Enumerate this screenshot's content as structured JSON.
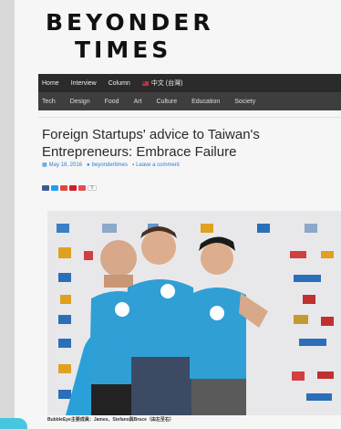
{
  "site": {
    "logo_line1": "BEYONDER",
    "logo_line2": "TIMES"
  },
  "nav_primary": [
    {
      "label": "Home"
    },
    {
      "label": "Interview"
    },
    {
      "label": "Column"
    },
    {
      "label": "中文 (台灣)",
      "icon": "taiwan-flag-icon"
    }
  ],
  "nav_secondary": [
    {
      "label": "Tech"
    },
    {
      "label": "Design"
    },
    {
      "label": "Food"
    },
    {
      "label": "Art"
    },
    {
      "label": "Culture"
    },
    {
      "label": "Education"
    },
    {
      "label": "Society"
    }
  ],
  "article": {
    "title": "Foreign Startups' advice to Taiwan's Entrepreneurs: Embrace Failure",
    "date": "May 18, 2016",
    "author": "beyondertimes",
    "comment": "Leave a comment",
    "share_count": "0",
    "caption": "BubbleEye主要成員：James、Stefano與Bruce（由左至右）"
  },
  "colors": {
    "nav_primary_bg": "#2b2b2b",
    "nav_secondary_bg": "#3e3e3e",
    "link_blue": "#2d7fd1",
    "shirt_blue": "#2f9fd6"
  }
}
